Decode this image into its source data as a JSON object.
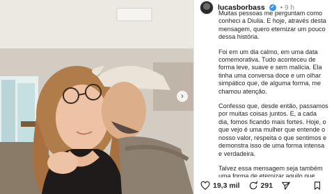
{
  "post": {
    "username": "lucasborbass",
    "time": "9 h",
    "caption": [
      "Muitas pessoas me perguntam como conheci a Diulia. E hoje, através desta mensagem, quero eternizar um pouco dessa história.",
      "Foi em um dia calmo, em uma data comemorativa. Tudo aconteceu de forma leve, suave e sem malícia. Ela tinha uma conversa doce e um olhar simpático que, de alguma forma, me chamou atenção.",
      "Confesso que, desde então, passamos por muitas coisas juntos. E, a cada dia, fomos ficando mais fortes. Hoje, o que vejo é uma mulher que entende o nosso valor, respeita o que sentimos e demonstra isso de uma forma intensa e verdadeira.",
      "Talvez essa mensagem seja também uma forma de eternizar aquilo que,"
    ],
    "likes": "19,3 mil",
    "comments": "291"
  },
  "icons": {
    "verified": "verified-badge-icon",
    "like": "heart-icon",
    "comment": "comment-icon",
    "share": "share-icon",
    "save": "bookmark-icon",
    "next": "chevron-right-icon"
  },
  "colors": {
    "verified": "#3897f0",
    "text": "#262626",
    "muted": "#8e8e8e"
  }
}
